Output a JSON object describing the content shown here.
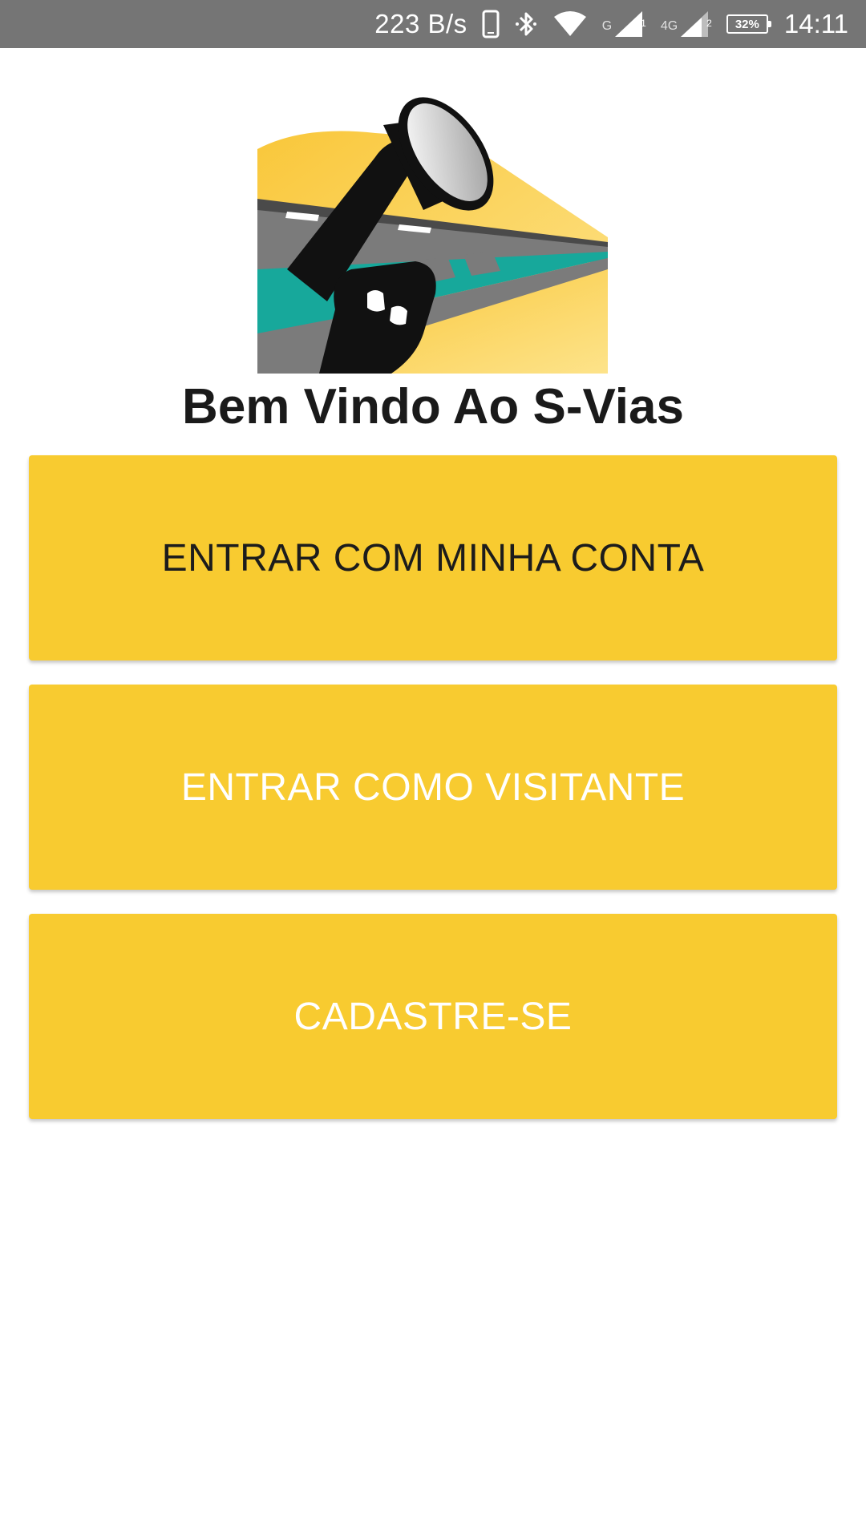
{
  "status_bar": {
    "net_speed": "223 B/s",
    "sim1_label": "G",
    "sim1_index": "1",
    "sim2_label": "4G",
    "sim2_index": "2",
    "battery": "32%",
    "time": "14:11",
    "icons": [
      "phone-icon",
      "bluetooth-icon",
      "wifi-icon",
      "signal-sim1-icon",
      "signal-sim2-icon",
      "battery-icon"
    ]
  },
  "app": {
    "logo_icon": "megaphone-fist-road-logo",
    "welcome_title": "Bem Vindo Ao S-Vias"
  },
  "buttons": {
    "login_label": "ENTRAR COM MINHA CONTA",
    "visitor_label": "ENTRAR COMO VISITANTE",
    "signup_label": "CADASTRE-SE"
  },
  "colors": {
    "button_background": "#f8cb30",
    "status_bar_background": "#757575",
    "logo_teal": "#17a89b",
    "logo_yellow": "#fcd34d"
  }
}
